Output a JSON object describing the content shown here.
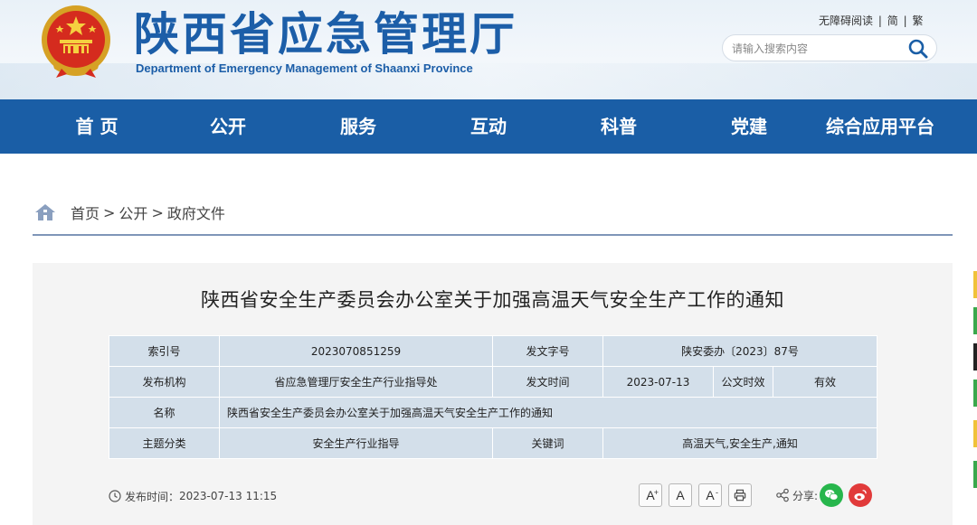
{
  "header": {
    "site_title": "陕西省应急管理厅",
    "site_subtitle": "Department of Emergency Management of Shaanxi Province",
    "accessibility_link": "无障碍阅读",
    "simplified_link": "简",
    "traditional_link": "繁",
    "separator": "|",
    "search_placeholder": "请输入搜索内容",
    "brand_color": "#1a5ea6"
  },
  "nav": {
    "items": [
      "首 页",
      "公开",
      "服务",
      "互动",
      "科普",
      "党建",
      "综合应用平台"
    ]
  },
  "breadcrumb": {
    "items": [
      "首页",
      "公开",
      "政府文件"
    ],
    "separator": ">"
  },
  "document": {
    "title": "陕西省安全生产委员会办公室关于加强高温天气安全生产工作的通知",
    "meta": {
      "index_label": "索引号",
      "index_value": "2023070851259",
      "doc_no_label": "发文字号",
      "doc_no_value": "陕安委办〔2023〕87号",
      "issuer_label": "发布机构",
      "issuer_value": "省应急管理厅安全生产行业指导处",
      "date_label": "发文时间",
      "date_value": "2023-07-13",
      "validity_label": "公文时效",
      "validity_value": "有效",
      "name_label": "名称",
      "name_value": "陕西省安全生产委员会办公室关于加强高温天气安全生产工作的通知",
      "category_label": "主题分类",
      "category_value": "安全生产行业指导",
      "keywords_label": "关键词",
      "keywords_value": "高温天气,安全生产,通知"
    },
    "publish_label": "发布时间：",
    "publish_time": "2023-07-13 11:15",
    "font_large": "A",
    "font_large_sup": "+",
    "font_normal": "A",
    "font_small": "A",
    "font_small_sup": "-",
    "share_label": "分享:"
  }
}
